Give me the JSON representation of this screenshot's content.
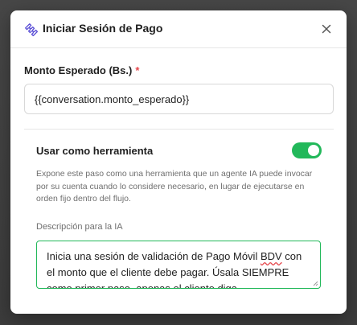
{
  "dialog": {
    "title": "Iniciar Sesión de Pago",
    "icon": "puzzle-icon",
    "close_icon": "close-icon"
  },
  "amount_field": {
    "label": "Monto Esperado (Bs.)",
    "required_marker": "*",
    "value": "{{conversation.monto_esperado}}"
  },
  "tool_section": {
    "toggle_label": "Usar como herramienta",
    "toggle_on": true,
    "help_text": "Expone este paso como una herramienta que un agente IA puede invocar por su cuenta cuando lo considere necesario, en lugar de ejecutarse en orden fijo dentro del flujo.",
    "description_label": "Descripción para la IA",
    "description_before": "Inicia una sesión de validación de Pago Móvil ",
    "description_flagged": "BDV",
    "description_after": " con el monto que el cliente debe pagar. Úsala SIEMPRE como primer paso, apenas el cliente diga"
  },
  "colors": {
    "accent_green": "#22b85a",
    "required_red": "#e5484d",
    "icon_purple": "#5b4fd6"
  }
}
